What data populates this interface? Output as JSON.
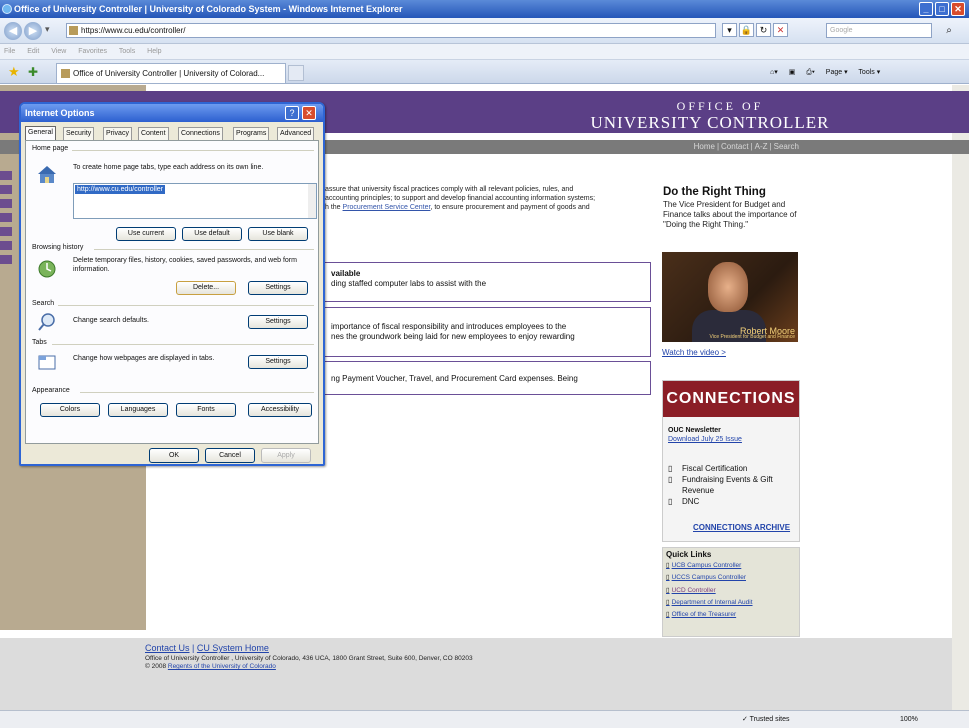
{
  "browser": {
    "title": "Office of University Controller | University of Colorado System - Windows Internet Explorer",
    "address": "https://www.cu.edu/controller/",
    "search_placeholder": "Google",
    "menu": [
      "File",
      "Edit",
      "View",
      "Favorites",
      "Tools",
      "Help"
    ],
    "tab_title": "Office of University Controller | University of Colorad...",
    "tools": {
      "page": "Page ▾",
      "tools": "Tools ▾"
    },
    "status_trusted": "✓ Trusted sites",
    "zoom": "100%"
  },
  "site": {
    "logo_sub": "OFFICE OF",
    "logo_main": "UNIVERSITY CONTROLLER",
    "nav": [
      "Home",
      "Contact",
      "A-Z",
      "Search"
    ],
    "intro_1": "assure that university fiscal practices comply with all relevant policies, rules, and",
    "intro_2": "accounting principles; to support and develop financial accounting information systems;",
    "intro_3": "h the",
    "intro_link": "Procurement Service Center",
    "intro_4": ", to ensure procurement and payment of goods and",
    "box1_title": "vailable",
    "box1_text": "ding staffed computer labs to assist with the",
    "box2_line1": "importance of fiscal responsibility and introduces employees to the",
    "box2_line2": "nes the groundwork being laid for new employees to enjoy rewarding",
    "box3_text": "ng Payment Voucher, Travel, and Procurement Card expenses. Being",
    "dtr_title": "Do the Right Thing",
    "dtr_body": "The Vice President for Budget and Finance talks about the importance of \"Doing the Right Thing.\"",
    "video_name": "Robert Moore",
    "video_caption": "Vice President for Budget and Finance",
    "watch": "Watch the video >",
    "conn_banner": "CONNECTIONS",
    "conn_newsletter": "OUC Newsletter",
    "conn_download": "Download July 25 Issue",
    "conn_items": [
      "Fiscal Certification",
      "Fundraising Events & Gift Revenue",
      "DNC"
    ],
    "conn_archive": "CONNECTIONS ARCHIVE",
    "ql_title": "Quick Links",
    "ql_items": [
      "UCB Campus Controller",
      "UCCS Campus Controller",
      "UCD Controller",
      "Department of Internal Audit",
      "Office of the Treasurer"
    ],
    "footer_contact": "Contact Us",
    "footer_sep": "|",
    "footer_home": "CU System Home",
    "footer_addr": "Office of University Controller , University of Colorado, 436 UCA, 1800 Grant Street, Suite 600, Denver, CO 80203",
    "footer_copy": "© 2008",
    "footer_regents": "Regents of the University of Colorado"
  },
  "dialog": {
    "title": "Internet Options",
    "tabs": [
      "General",
      "Security",
      "Privacy",
      "Content",
      "Connections",
      "Programs",
      "Advanced"
    ],
    "home_label": "Home page",
    "home_text": "To create home page tabs, type each address on its own line.",
    "home_value": "http://www.cu.edu/controller",
    "btn_use_current": "Use current",
    "btn_use_default": "Use default",
    "btn_use_blank": "Use blank",
    "history_label": "Browsing history",
    "history_text": "Delete temporary files, history, cookies, saved passwords, and web form information.",
    "btn_delete": "Delete...",
    "btn_settings": "Settings",
    "search_label": "Search",
    "search_text": "Change search defaults.",
    "tabs_label": "Tabs",
    "tabs_text": "Change how webpages are displayed in tabs.",
    "appearance_label": "Appearance",
    "btn_colors": "Colors",
    "btn_languages": "Languages",
    "btn_fonts": "Fonts",
    "btn_accessibility": "Accessibility",
    "btn_ok": "OK",
    "btn_cancel": "Cancel",
    "btn_apply": "Apply"
  }
}
